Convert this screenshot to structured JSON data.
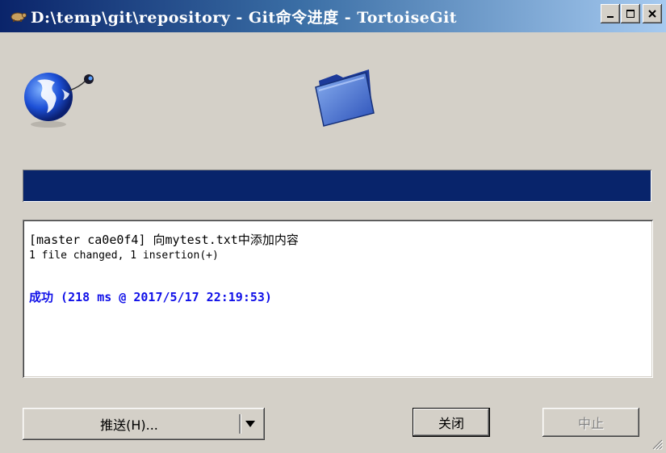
{
  "window": {
    "title": "D:\\temp\\git\\repository - Git命令进度 - TortoiseGit",
    "controls": {
      "minimize": "_",
      "maximize": "□",
      "close": "×"
    }
  },
  "progress": {
    "fraction": 1.0,
    "color": "#08246b"
  },
  "log": {
    "line1": "[master ca0e0f4] 向mytest.txt中添加内容",
    "line2": " 1 file changed, 1 insertion(+)",
    "success_label": "成功",
    "success_detail": " (218 ms @ 2017/5/17 22:19:53)",
    "success_color": "#1010e8"
  },
  "buttons": {
    "push": "推送(H)...",
    "close": "关闭",
    "abort": "中止"
  },
  "icons": {
    "title": "tortoise-icon",
    "source": "globe-network-icon",
    "target": "folder-icon"
  }
}
